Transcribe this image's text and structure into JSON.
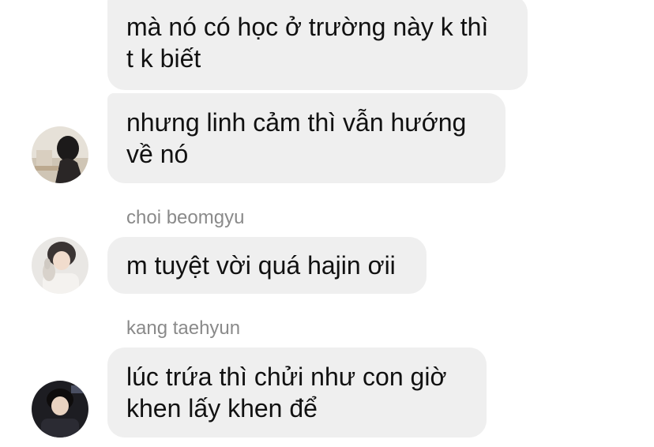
{
  "messages": [
    {
      "text": "mà nó có học ở trường này k thì\nt k biết"
    },
    {
      "text": "nhưng linh cảm thì vẫn hướng\nvề nó"
    },
    {
      "sender": "choi beomgyu",
      "text": "m tuyệt vời quá hajin ơii"
    },
    {
      "sender": "kang taehyun",
      "text": "lúc trứa thì chửi như con giờ\nkhen lấy khen để"
    }
  ],
  "colors": {
    "bubble": "#efefef",
    "sender": "#8a8a8a",
    "text": "#111111"
  }
}
